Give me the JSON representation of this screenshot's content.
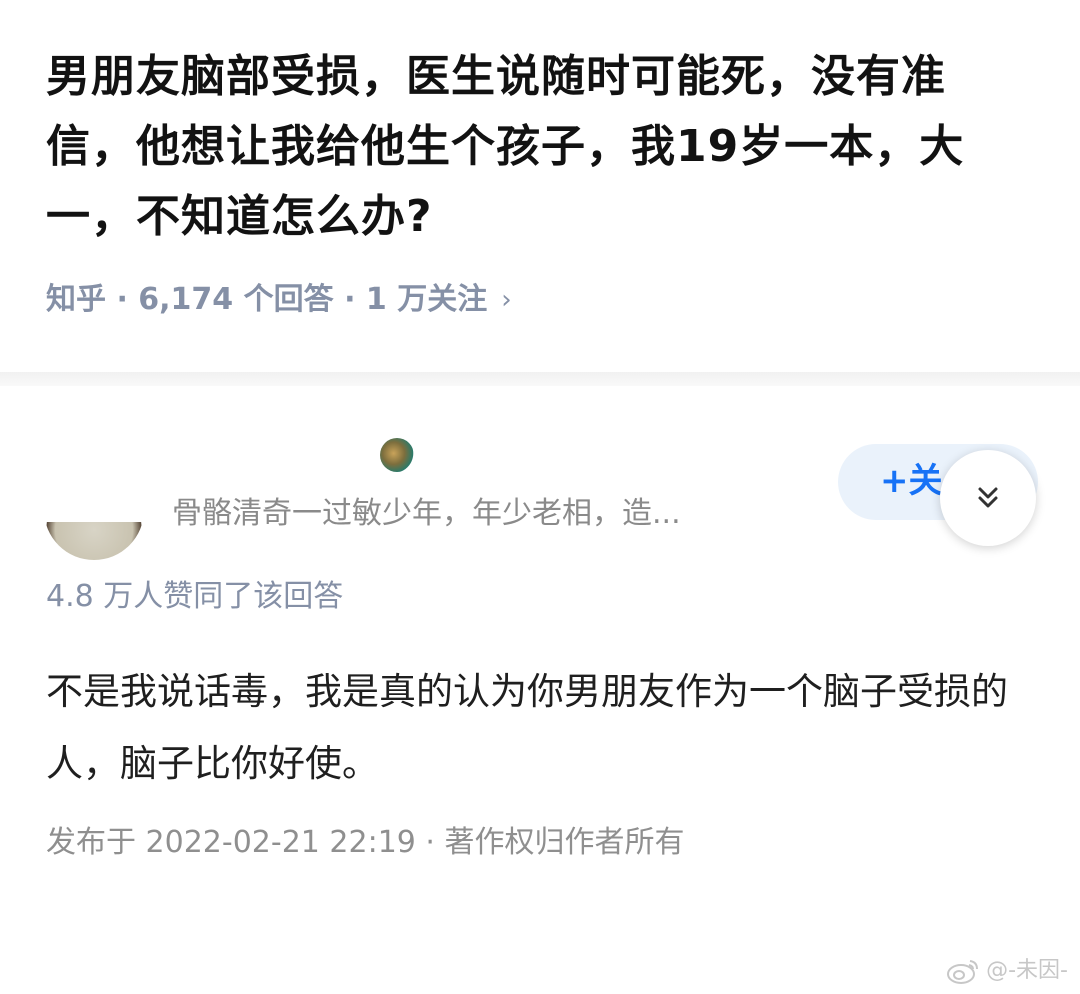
{
  "question": {
    "title": "男朋友脑部受损，医生说随时可能死，没有准信，他想让我给他生个孩子，我19岁一本，大一，不知道怎么办?",
    "meta": "知乎 · 6,174 个回答 · 1 万关注",
    "meta_icon": "chevron-right-icon"
  },
  "answer": {
    "author_bio": "骨骼清奇一过敏少年，年少老相，造...",
    "follow_label": "+关",
    "votes": "4.8 万人赞同了该回答",
    "body": "不是我说话毒，我是真的认为你男朋友作为一个脑子受损的人，脑子比你好使。",
    "published": "发布于 2022-02-21 22:19 · 著作权归作者所有"
  },
  "watermark": {
    "text": "@-未因-",
    "icon": "weibo-icon"
  },
  "colors": {
    "accent": "#1772f6",
    "meta_gray": "#8590a6",
    "follow_bg": "#eaf2fb"
  }
}
